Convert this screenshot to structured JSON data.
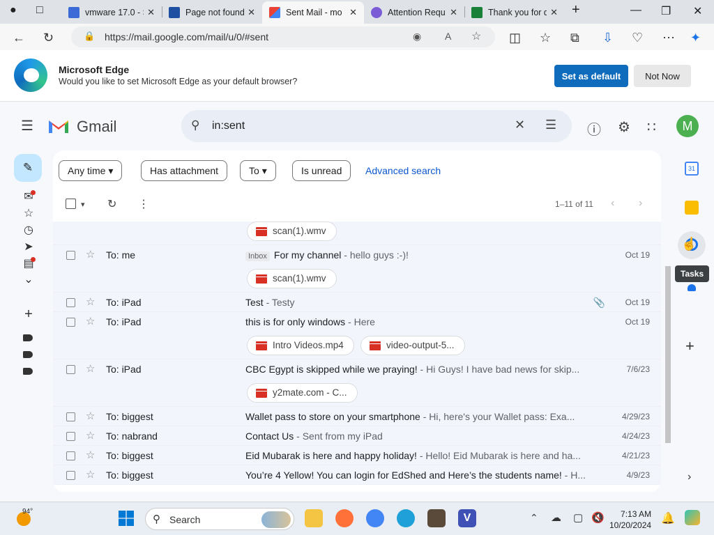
{
  "browser": {
    "tabs": [
      {
        "title": "vmware 17.0 - S",
        "favicon": "search-icon"
      },
      {
        "title": "Page not found",
        "favicon": "vmware-icon"
      },
      {
        "title": "Sent Mail - mo",
        "favicon": "gmail-icon",
        "active": true
      },
      {
        "title": "Attention Requ",
        "favicon": "site-icon"
      },
      {
        "title": "Thank you for d",
        "favicon": "sheet-icon"
      }
    ],
    "url": "https://mail.google.com/mail/u/0/#sent"
  },
  "default_prompt": {
    "title": "Microsoft Edge",
    "message": "Would you like to set Microsoft Edge as your default browser?",
    "set_default_label": "Set as default",
    "not_now_label": "Not Now"
  },
  "gmail": {
    "logo_text": "Gmail",
    "search_query": "in:sent",
    "avatar_letter": "M",
    "filters": {
      "any_time": "Any time",
      "has_attachment": "Has attachment",
      "to": "To",
      "is_unread": "Is unread",
      "advanced": "Advanced search"
    },
    "page_count": "1–11 of 11",
    "tooltip": "Tasks",
    "rows": [
      {
        "to": "To: me",
        "tag": "Inbox",
        "subject": "For my channel",
        "snippet": " - hello guys :-)!",
        "date": "Oct 19"
      },
      {
        "to": "To: iPad",
        "subject": "Test",
        "snippet": " - Testy",
        "date": "Oct 19"
      },
      {
        "to": "To: iPad",
        "subject": "this is for only windows",
        "snippet": " - Here",
        "date": "Oct 19"
      },
      {
        "to": "To: iPad",
        "subject": "CBC Egypt is skipped while we praying!",
        "snippet": " - Hi Guys! I have bad news for skip...",
        "date": "7/6/23"
      },
      {
        "to": "To: biggest",
        "subject": "Wallet pass to store on your smartphone",
        "snippet": " - Hi, here's your Wallet pass: Exa...",
        "date": "4/29/23"
      },
      {
        "to": "To: nabrand",
        "subject": "Contact Us",
        "snippet": " - Sent from my iPad",
        "date": "4/24/23"
      },
      {
        "to": "To: biggest",
        "subject": "Eid Mubarak is here and happy holiday!",
        "snippet": " - Hello! Eid Mubarak is here and ha...",
        "date": "4/21/23"
      },
      {
        "to": "To: biggest",
        "subject": "You’re 4 Yellow! You can login for EdShed and Here’s the students name!",
        "snippet": " - H...",
        "date": "4/9/23"
      }
    ],
    "attachments": {
      "top": "scan(1).wmv",
      "row0": "scan(1).wmv",
      "row2a": "Intro Videos.mp4",
      "row2b": "video-output-5...",
      "row3": "y2mate.com - C..."
    }
  },
  "taskbar": {
    "weather": "94°",
    "search_label": "Search",
    "time": "7:13 AM",
    "date": "10/20/2024"
  },
  "colors": {
    "accent": "#0b57d0",
    "edge_blue": "#0f6cbd",
    "compose": "#c2e7ff"
  }
}
